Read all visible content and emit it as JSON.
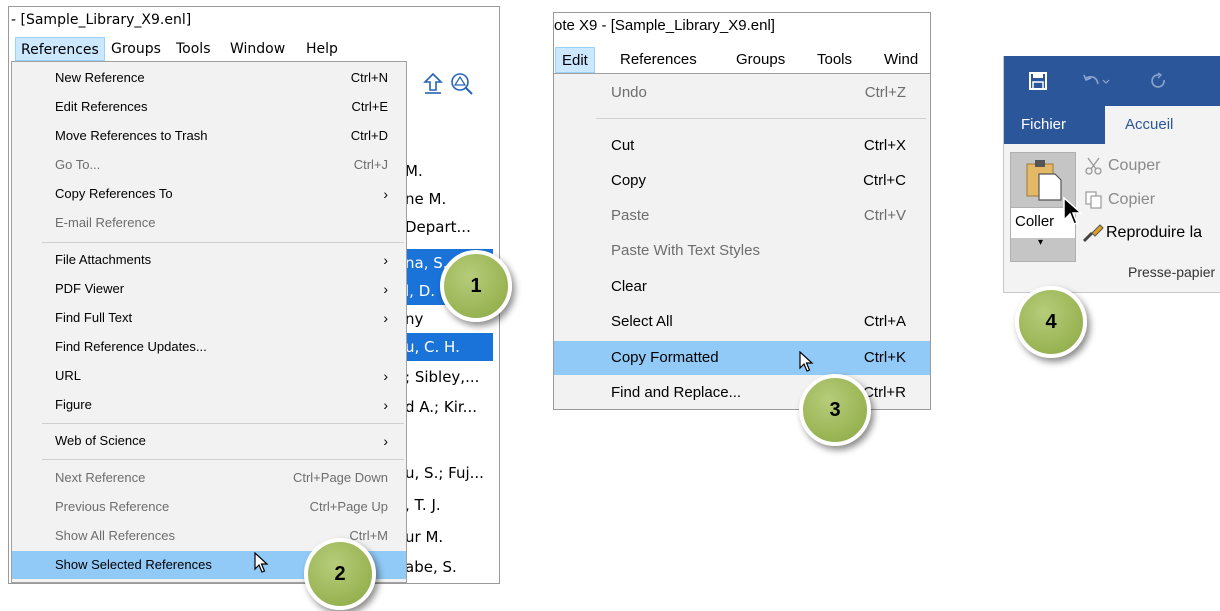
{
  "panel1": {
    "title": "- [Sample_Library_X9.enl]",
    "menubar": [
      "References",
      "Groups",
      "Tools",
      "Window",
      "Help"
    ],
    "background_authors": [
      "M.",
      "ne M.",
      "Depart...",
      "na, S.",
      "l, D.",
      "ny",
      "u, C. H.",
      "; Sibley,...",
      "d A.; Kir...",
      "",
      "u, S.; Fuj...",
      ", T. J.",
      "ur M.",
      "abe, S."
    ],
    "menu": {
      "new_reference": "New Reference",
      "new_reference_sc": "Ctrl+N",
      "edit_references": "Edit References",
      "edit_references_sc": "Ctrl+E",
      "move_trash": "Move References to Trash",
      "move_trash_sc": "Ctrl+D",
      "go_to": "Go To...",
      "go_to_sc": "Ctrl+J",
      "copy_refs_to": "Copy References To",
      "email_ref": "E-mail Reference",
      "file_attachments": "File Attachments",
      "pdf_viewer": "PDF Viewer",
      "find_full_text": "Find Full Text",
      "find_updates": "Find Reference Updates...",
      "url": "URL",
      "figure": "Figure",
      "web_of_science": "Web of Science",
      "next_ref": "Next Reference",
      "next_ref_sc": "Ctrl+Page Down",
      "prev_ref": "Previous Reference",
      "prev_ref_sc": "Ctrl+Page Up",
      "show_all": "Show All References",
      "show_all_sc": "Ctrl+M",
      "show_selected": "Show Selected References"
    },
    "arrow_glyph": "›"
  },
  "panel2": {
    "title": "ote X9 - [Sample_Library_X9.enl]",
    "menubar": [
      "Edit",
      "References",
      "Groups",
      "Tools",
      "Wind"
    ],
    "menu": {
      "undo": "Undo",
      "undo_sc": "Ctrl+Z",
      "cut": "Cut",
      "cut_sc": "Ctrl+X",
      "copy": "Copy",
      "copy_sc": "Ctrl+C",
      "paste": "Paste",
      "paste_sc": "Ctrl+V",
      "paste_styles": "Paste With Text Styles",
      "clear": "Clear",
      "select_all": "Select All",
      "select_all_sc": "Ctrl+A",
      "copy_formatted": "Copy Formatted",
      "copy_formatted_sc": "Ctrl+K",
      "find_replace": "Find and Replace...",
      "find_replace_sc": "Ctrl+R"
    }
  },
  "panel3": {
    "tab_file": "Fichier",
    "tab_home": "Accueil",
    "paste_label": "Coller",
    "cut_label": "Couper",
    "copy_label": "Copier",
    "format_painter_label": "Reproduire la",
    "group_label": "Presse-papier"
  },
  "badges": [
    "1",
    "2",
    "3",
    "4"
  ],
  "colors": {
    "menu_highlight": "#91c9f7",
    "selection_blue": "#1a73d9",
    "word_blue": "#2b579a",
    "badge_green": "#98b352"
  }
}
